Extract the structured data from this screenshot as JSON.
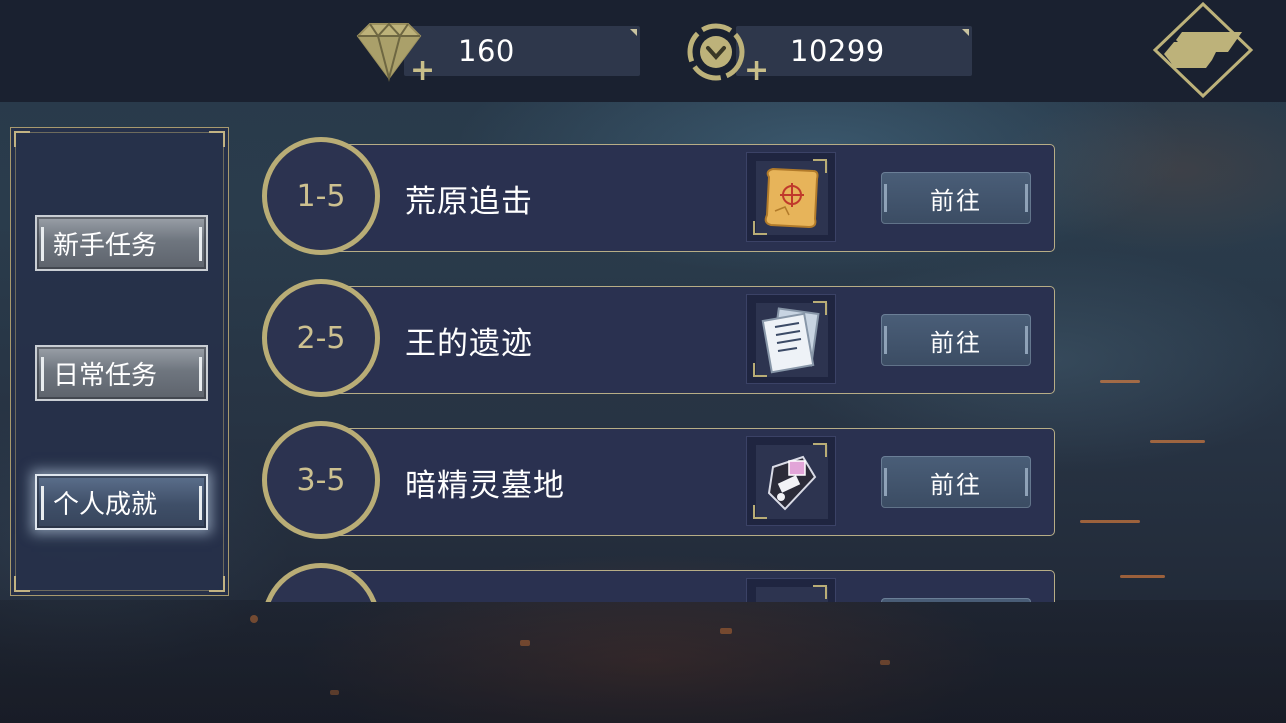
{
  "currencies": {
    "gems": {
      "value": "160",
      "icon": "diamond-icon",
      "plus": "+"
    },
    "coins": {
      "value": "10299",
      "icon": "chevron-coin-icon",
      "plus": "+"
    }
  },
  "back_button": {
    "icon": "back-arrow-icon"
  },
  "sidebar": {
    "tabs": [
      {
        "label": "新手任务",
        "active": false
      },
      {
        "label": "日常任务",
        "active": false
      },
      {
        "label": "个人成就",
        "active": true
      }
    ]
  },
  "quests": [
    {
      "stage": "1-5",
      "name": "荒原追击",
      "item_icon": "treasure-map-scroll-icon",
      "button": "前往"
    },
    {
      "stage": "2-5",
      "name": "王的遗迹",
      "item_icon": "ancient-document-icon",
      "button": "前往"
    },
    {
      "stage": "3-5",
      "name": "暗精灵墓地",
      "item_icon": "dark-device-icon",
      "button": "前往"
    },
    {
      "stage": "",
      "name": "",
      "item_icon": "item-icon",
      "button": ""
    }
  ],
  "colors": {
    "gold_accent": "#b9ad76",
    "card_bg": "#2a3150",
    "topbar_bg": "#1a2130"
  }
}
